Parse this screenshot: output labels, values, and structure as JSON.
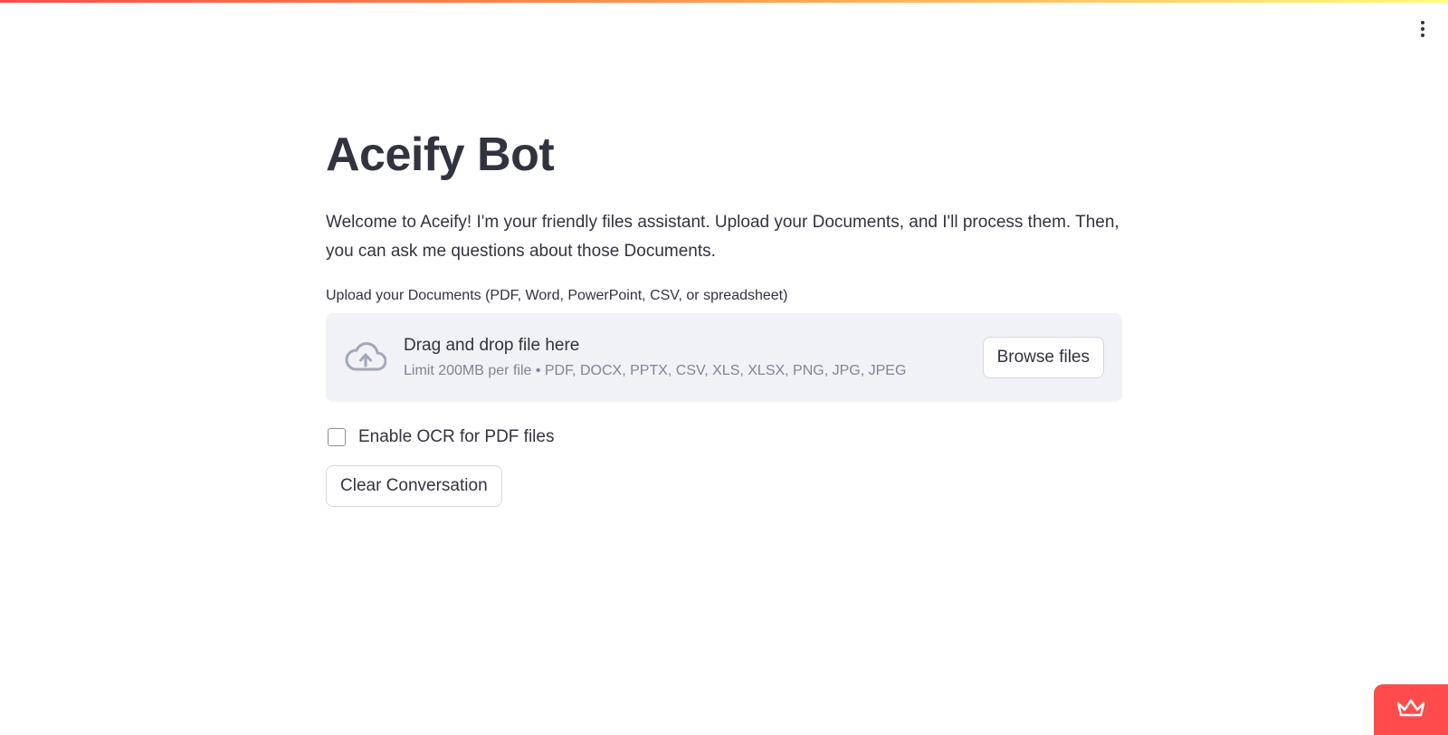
{
  "app": {
    "title": "Aceify Bot",
    "intro": "Welcome to Aceify! I'm your friendly files assistant. Upload your Documents, and I'll process them. Then, you can ask me questions about those Documents."
  },
  "uploader": {
    "label": "Upload your Documents (PDF, Word, PowerPoint, CSV, or spreadsheet)",
    "drop_title": "Drag and drop file here",
    "limit_text": "Limit 200MB per file • PDF, DOCX, PPTX, CSV, XLS, XLSX, PNG, JPG, JPEG",
    "browse_label": "Browse files",
    "icon": "cloud-upload-icon"
  },
  "ocr_option": {
    "label": "Enable OCR for PDF files",
    "checked": false
  },
  "actions": {
    "clear_label": "Clear Conversation"
  },
  "header": {
    "menu_icon": "kebab-menu-icon"
  },
  "footer": {
    "badge_icon": "crown-icon"
  },
  "colors": {
    "accent": "#ff4b4b",
    "text": "#31333f",
    "muted": "#808495",
    "dropzone_bg": "#f0f2f6"
  }
}
